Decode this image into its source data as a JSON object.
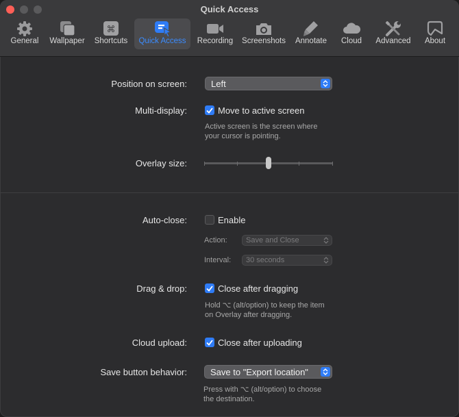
{
  "window": {
    "title": "Quick Access"
  },
  "tabs": [
    {
      "label": "General",
      "icon": "gear-icon",
      "active": false
    },
    {
      "label": "Wallpaper",
      "icon": "wallpaper-icon",
      "active": false
    },
    {
      "label": "Shortcuts",
      "icon": "command-key-icon",
      "active": false
    },
    {
      "label": "Quick Access",
      "icon": "quick-access-icon",
      "active": true
    },
    {
      "label": "Recording",
      "icon": "video-camera-icon",
      "active": false
    },
    {
      "label": "Screenshots",
      "icon": "camera-icon",
      "active": false
    },
    {
      "label": "Annotate",
      "icon": "highlighter-icon",
      "active": false
    },
    {
      "label": "Cloud",
      "icon": "cloud-icon",
      "active": false
    },
    {
      "label": "Advanced",
      "icon": "tools-icon",
      "active": false
    },
    {
      "label": "About",
      "icon": "about-icon",
      "active": false
    }
  ],
  "position": {
    "label": "Position on screen:",
    "value": "Left"
  },
  "multi_display": {
    "label": "Multi-display:",
    "checkbox_label": "Move to active screen",
    "checked": true,
    "help_line1": "Active screen is the screen where",
    "help_line2": "your cursor is pointing."
  },
  "overlay_size": {
    "label": "Overlay size:",
    "ticks": 5,
    "value_fraction": 0.5
  },
  "auto_close": {
    "label": "Auto-close:",
    "checkbox_label": "Enable",
    "checked": false,
    "action_label": "Action:",
    "action_value": "Save and Close",
    "interval_label": "Interval:",
    "interval_value": "30 seconds"
  },
  "drag_drop": {
    "label": "Drag & drop:",
    "checkbox_label": "Close after dragging",
    "checked": true,
    "help_line1": "Hold ⌥ (alt/option) to keep the item",
    "help_line2": "on Overlay after dragging."
  },
  "cloud_upload": {
    "label": "Cloud upload:",
    "checkbox_label": "Close after uploading",
    "checked": true
  },
  "save_button": {
    "label": "Save button behavior:",
    "value": "Save to \"Export location\"",
    "help_line1": "Press with ⌥ (alt/option) to choose",
    "help_line2": "the destination."
  },
  "colors": {
    "accent": "#2f7cf6",
    "tab_active_text": "#3b8cff"
  }
}
